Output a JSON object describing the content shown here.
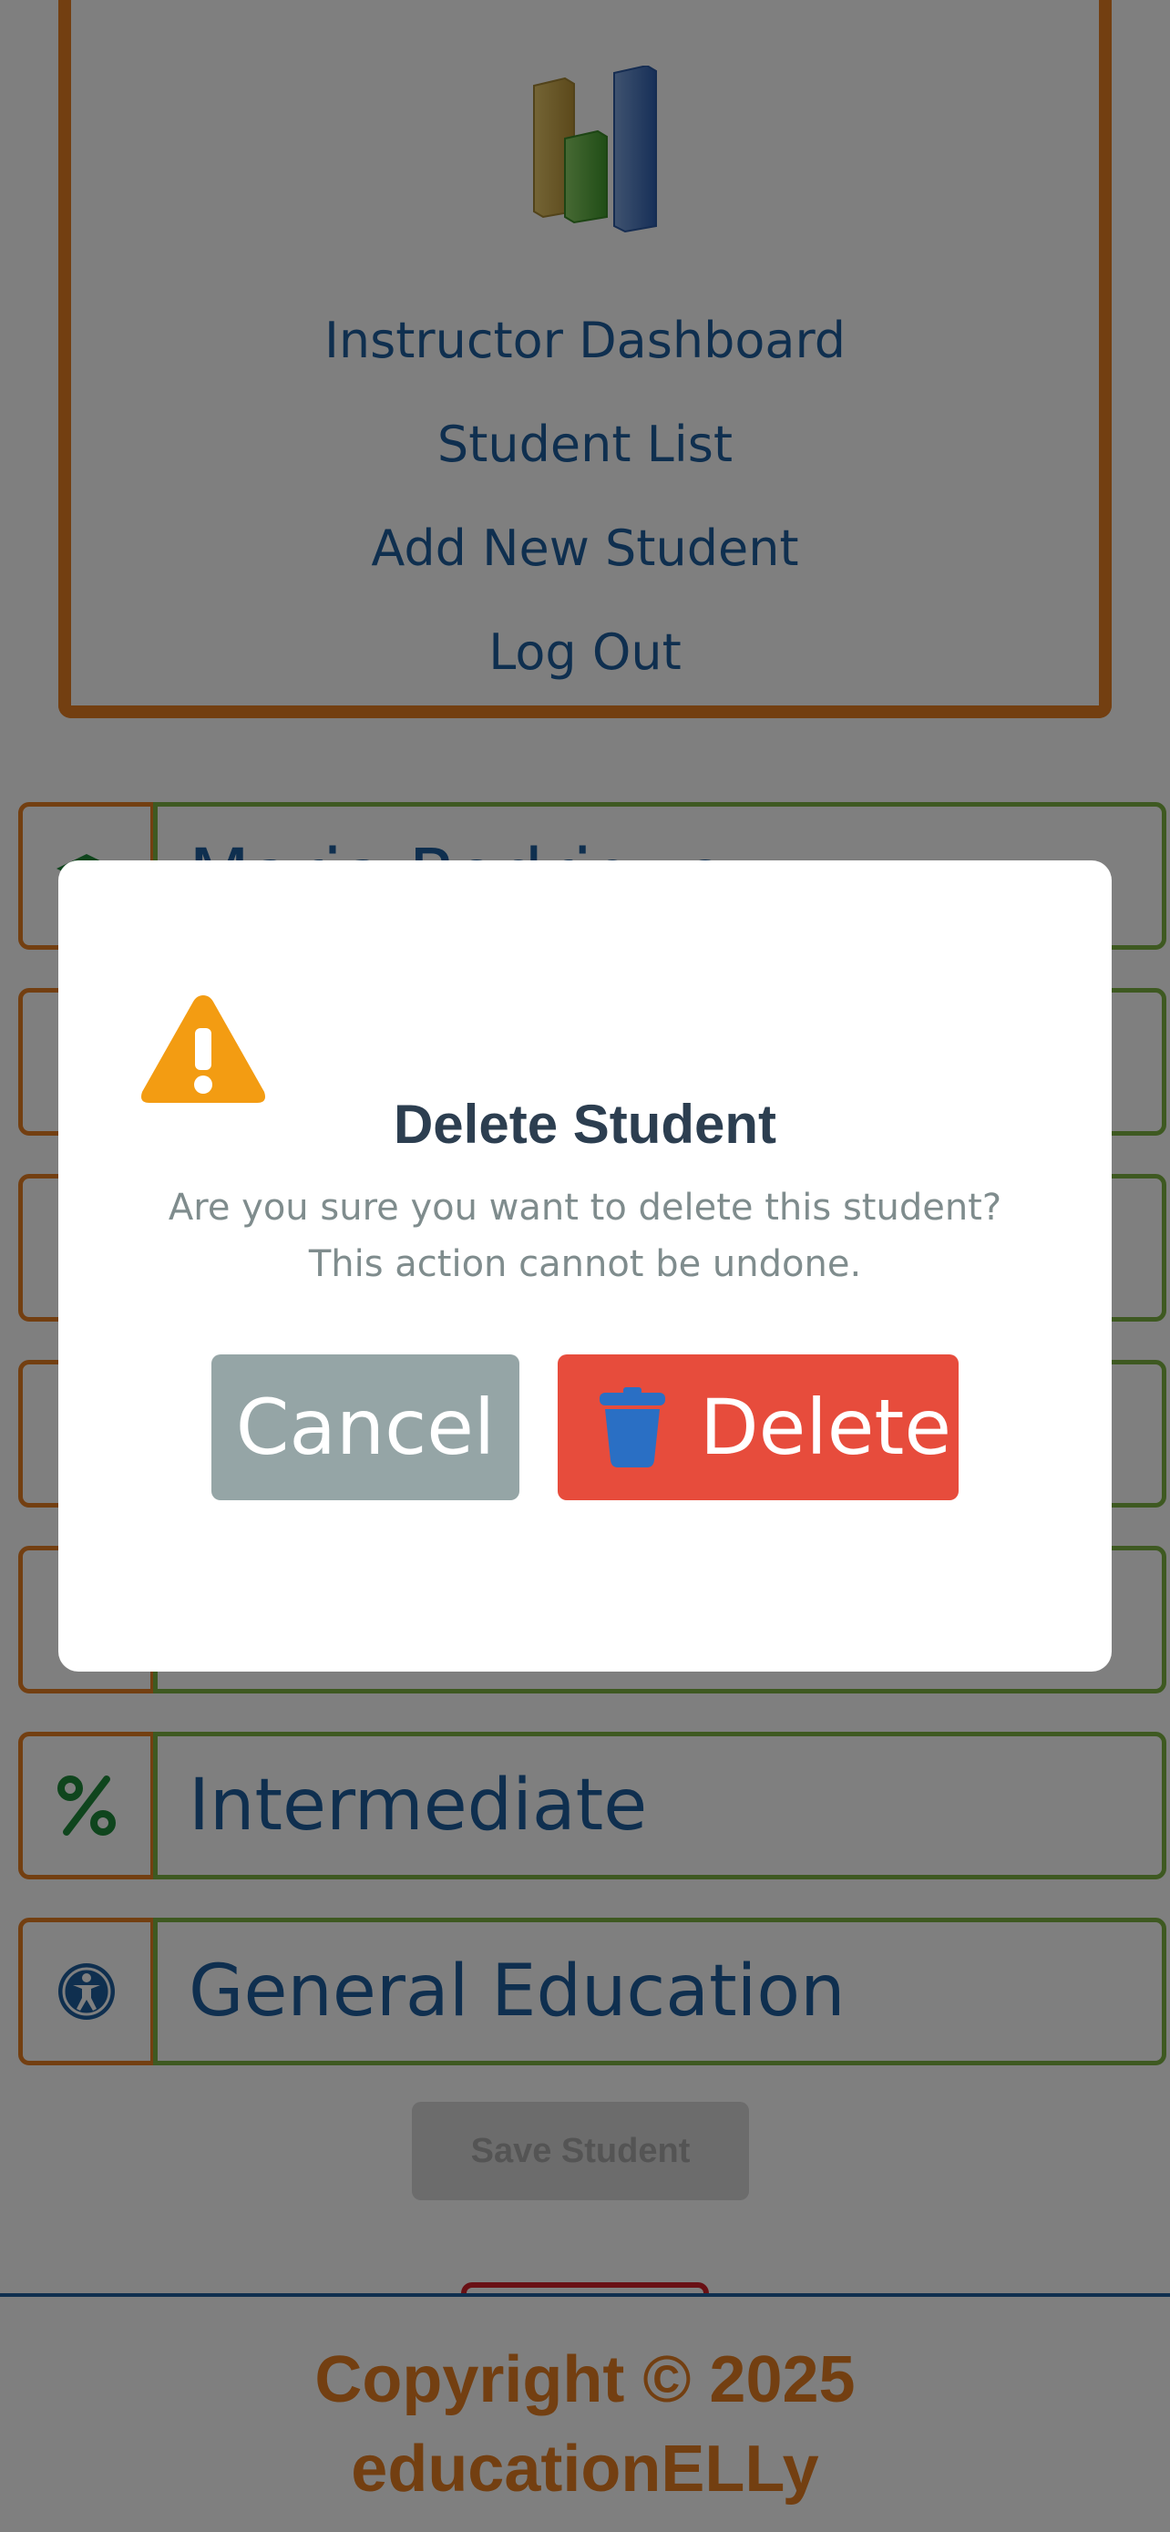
{
  "nav": {
    "links": [
      "Instructor Dashboard",
      "Student List",
      "Add New Student",
      "Log Out"
    ]
  },
  "form": {
    "rows": [
      {
        "icon": "graduation-cap-icon",
        "value": "Maria Rodriguez"
      },
      {
        "icon": "field-icon",
        "value": ""
      },
      {
        "icon": "field-icon",
        "value": ""
      },
      {
        "icon": "field-icon",
        "value": ""
      },
      {
        "icon": "field-icon",
        "value": ""
      },
      {
        "icon": "percent-icon",
        "value": "Intermediate"
      },
      {
        "icon": "accessibility-icon",
        "value": "General Education"
      }
    ],
    "save_label": "Save Student"
  },
  "footer": {
    "line1": "Copyright © 2025",
    "line2": "educationELLy"
  },
  "modal": {
    "title": "Delete Student",
    "message": "Are you sure you want to delete this student? This action cannot be undone.",
    "cancel_label": "Cancel",
    "delete_label": "Delete"
  },
  "colors": {
    "accent_orange": "#e67e22",
    "field_green": "#7cb342",
    "link_blue": "#1f5f9e",
    "delete_red": "#e74c3c",
    "cancel_gray": "#95a5a6",
    "warning": "#f39c12"
  }
}
